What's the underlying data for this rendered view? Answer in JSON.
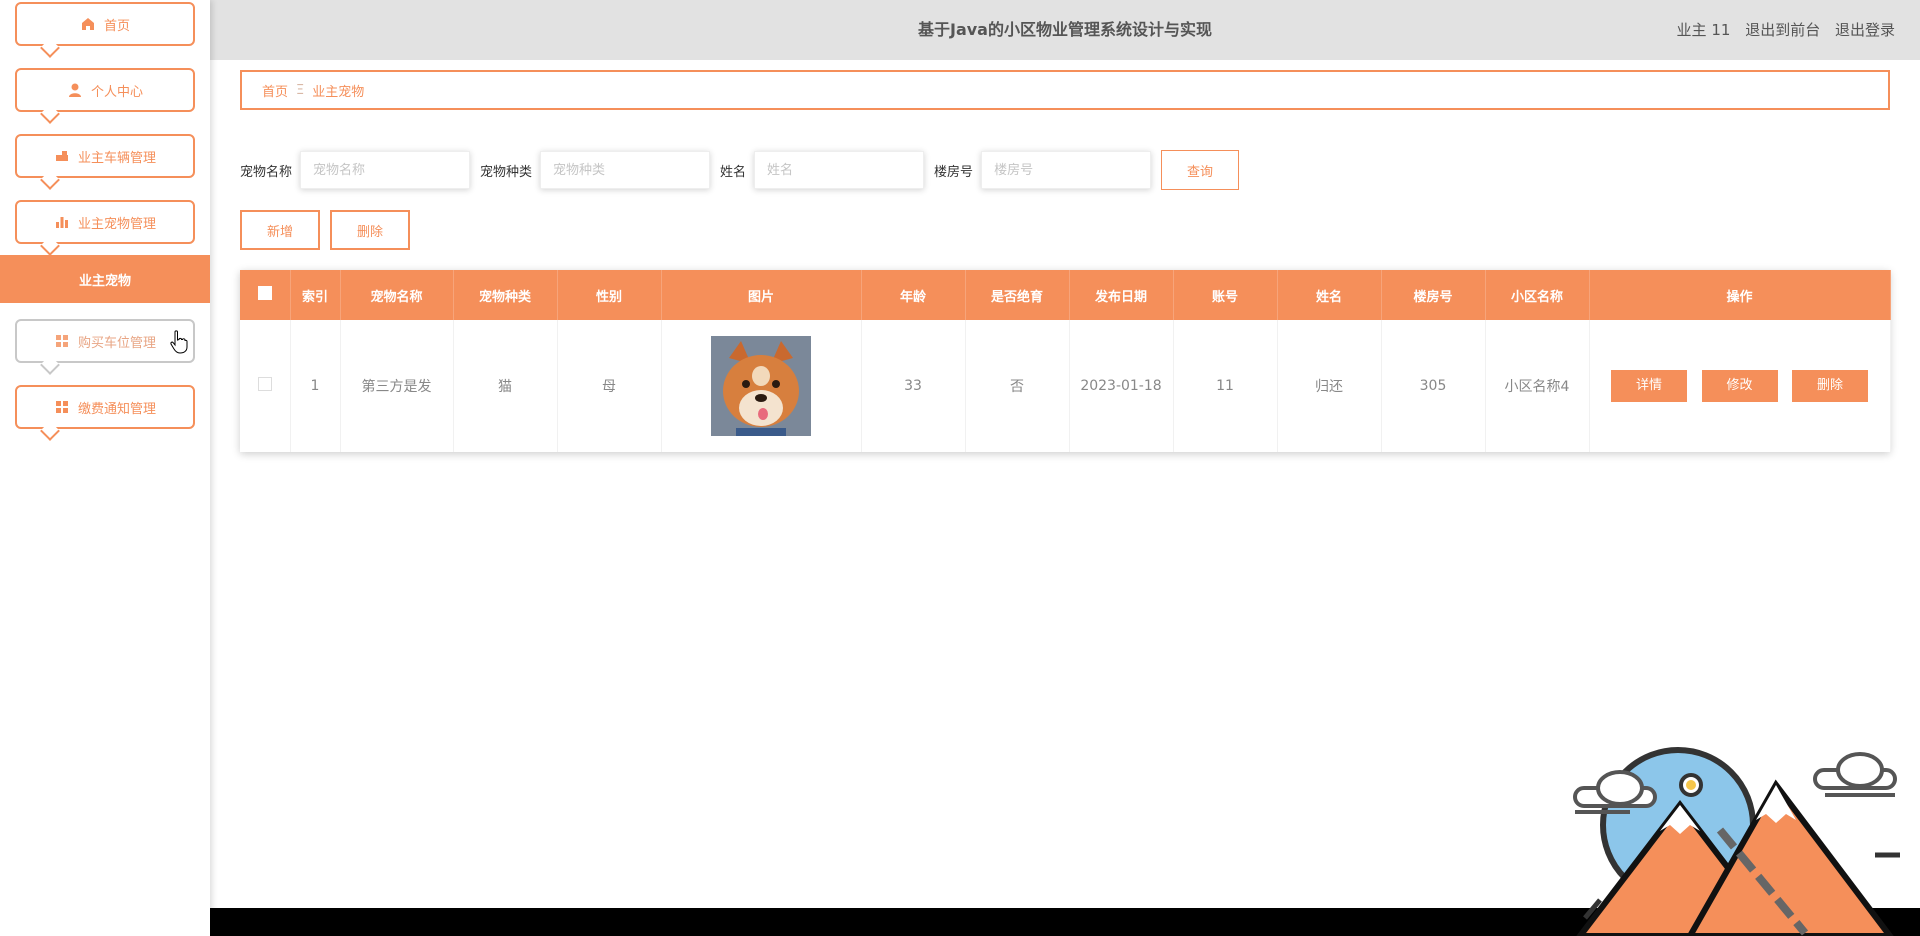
{
  "header": {
    "title": "基于Java的小区物业管理系统设计与实现",
    "user_label": "业主 11",
    "exit_front_label": "退出到前台",
    "logout_label": "退出登录"
  },
  "sidebar": {
    "items": [
      {
        "label": "首页",
        "icon": "home-icon"
      },
      {
        "label": "个人中心",
        "icon": "user-icon"
      },
      {
        "label": "业主车辆管理",
        "icon": "car-icon"
      },
      {
        "label": "业主宠物管理",
        "icon": "bar-chart-icon"
      },
      {
        "label": "购买车位管理",
        "icon": "grid-icon"
      },
      {
        "label": "缴费通知管理",
        "icon": "grid-icon"
      }
    ],
    "active_submenu": "业主宠物"
  },
  "breadcrumb": {
    "home": "首页",
    "separator": "Ξ",
    "current": "业主宠物"
  },
  "search": {
    "fields": [
      {
        "label": "宠物名称",
        "placeholder": "宠物名称"
      },
      {
        "label": "宠物种类",
        "placeholder": "宠物种类"
      },
      {
        "label": "姓名",
        "placeholder": "姓名"
      },
      {
        "label": "楼房号",
        "placeholder": "楼房号"
      }
    ],
    "query_label": "查询"
  },
  "actions": {
    "add_label": "新增",
    "delete_label": "删除"
  },
  "table": {
    "headers": [
      "索引",
      "宠物名称",
      "宠物种类",
      "性别",
      "图片",
      "年龄",
      "是否绝育",
      "发布日期",
      "账号",
      "姓名",
      "楼房号",
      "小区名称",
      "操作"
    ],
    "rows": [
      {
        "index": "1",
        "pet_name": "第三方是发",
        "pet_type": "猫",
        "gender": "母",
        "age": "33",
        "neutered": "否",
        "date": "2023-01-18",
        "account": "11",
        "name": "归还",
        "building": "305",
        "community": "小区名称4",
        "ops": {
          "detail": "详情",
          "edit": "修改",
          "delete": "删除"
        }
      }
    ]
  },
  "colors": {
    "accent": "#f58f5a",
    "header_bg": "#e2e2e2"
  }
}
